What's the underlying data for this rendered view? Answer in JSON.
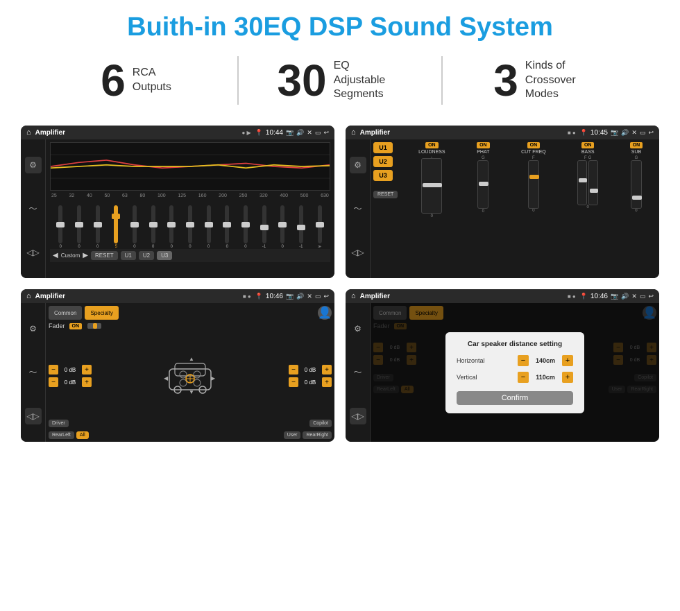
{
  "page": {
    "title": "Buith-in 30EQ DSP Sound System"
  },
  "stats": [
    {
      "number": "6",
      "label1": "RCA",
      "label2": "Outputs"
    },
    {
      "number": "30",
      "label1": "EQ Adjustable",
      "label2": "Segments"
    },
    {
      "number": "3",
      "label1": "Kinds of",
      "label2": "Crossover Modes"
    }
  ],
  "screens": {
    "eq_title": "Amplifier",
    "eq_time": "10:44",
    "crossover_title": "Amplifier",
    "crossover_time": "10:45",
    "fader_title": "Amplifier",
    "fader_time": "10:46",
    "distance_title": "Amplifier",
    "distance_time": "10:46",
    "eq_freqs": [
      "25",
      "32",
      "40",
      "50",
      "63",
      "80",
      "100",
      "125",
      "160",
      "200",
      "250",
      "320",
      "400",
      "500",
      "630"
    ],
    "eq_values": [
      "0",
      "0",
      "0",
      "5",
      "0",
      "0",
      "0",
      "0",
      "0",
      "0",
      "0",
      "-1",
      "0",
      "-1"
    ],
    "eq_preset": "Custom",
    "eq_btns": [
      "RESET",
      "U1",
      "U2",
      "U3"
    ],
    "presets": [
      "U1",
      "U2",
      "U3"
    ],
    "crossover_controls": [
      "LOUDNESS",
      "PHAT",
      "CUT FREQ",
      "BASS",
      "SUB"
    ],
    "fader_label": "Fader",
    "fader_on": "ON",
    "db_left_top": "0 dB",
    "db_left_bottom": "0 dB",
    "db_right_top": "0 dB",
    "db_right_bottom": "0 dB",
    "fader_buttons": [
      "Driver",
      "Copilot",
      "RearLeft",
      "All",
      "User",
      "RearRight"
    ],
    "modal_title": "Car speaker distance setting",
    "modal_horizontal_label": "Horizontal",
    "modal_horizontal_value": "140cm",
    "modal_vertical_label": "Vertical",
    "modal_vertical_value": "110cm",
    "confirm_label": "Confirm",
    "tabs_common": "Common",
    "tabs_specialty": "Specialty"
  }
}
